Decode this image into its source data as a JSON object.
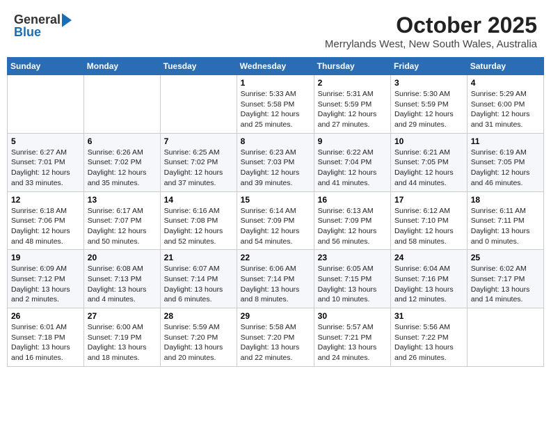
{
  "header": {
    "logo_line1": "General",
    "logo_line2": "Blue",
    "title": "October 2025",
    "subtitle": "Merrylands West, New South Wales, Australia"
  },
  "calendar": {
    "days_of_week": [
      "Sunday",
      "Monday",
      "Tuesday",
      "Wednesday",
      "Thursday",
      "Friday",
      "Saturday"
    ],
    "weeks": [
      [
        {
          "day": "",
          "info": ""
        },
        {
          "day": "",
          "info": ""
        },
        {
          "day": "",
          "info": ""
        },
        {
          "day": "1",
          "info": "Sunrise: 5:33 AM\nSunset: 5:58 PM\nDaylight: 12 hours and 25 minutes."
        },
        {
          "day": "2",
          "info": "Sunrise: 5:31 AM\nSunset: 5:59 PM\nDaylight: 12 hours and 27 minutes."
        },
        {
          "day": "3",
          "info": "Sunrise: 5:30 AM\nSunset: 5:59 PM\nDaylight: 12 hours and 29 minutes."
        },
        {
          "day": "4",
          "info": "Sunrise: 5:29 AM\nSunset: 6:00 PM\nDaylight: 12 hours and 31 minutes."
        }
      ],
      [
        {
          "day": "5",
          "info": "Sunrise: 6:27 AM\nSunset: 7:01 PM\nDaylight: 12 hours and 33 minutes."
        },
        {
          "day": "6",
          "info": "Sunrise: 6:26 AM\nSunset: 7:02 PM\nDaylight: 12 hours and 35 minutes."
        },
        {
          "day": "7",
          "info": "Sunrise: 6:25 AM\nSunset: 7:02 PM\nDaylight: 12 hours and 37 minutes."
        },
        {
          "day": "8",
          "info": "Sunrise: 6:23 AM\nSunset: 7:03 PM\nDaylight: 12 hours and 39 minutes."
        },
        {
          "day": "9",
          "info": "Sunrise: 6:22 AM\nSunset: 7:04 PM\nDaylight: 12 hours and 41 minutes."
        },
        {
          "day": "10",
          "info": "Sunrise: 6:21 AM\nSunset: 7:05 PM\nDaylight: 12 hours and 44 minutes."
        },
        {
          "day": "11",
          "info": "Sunrise: 6:19 AM\nSunset: 7:05 PM\nDaylight: 12 hours and 46 minutes."
        }
      ],
      [
        {
          "day": "12",
          "info": "Sunrise: 6:18 AM\nSunset: 7:06 PM\nDaylight: 12 hours and 48 minutes."
        },
        {
          "day": "13",
          "info": "Sunrise: 6:17 AM\nSunset: 7:07 PM\nDaylight: 12 hours and 50 minutes."
        },
        {
          "day": "14",
          "info": "Sunrise: 6:16 AM\nSunset: 7:08 PM\nDaylight: 12 hours and 52 minutes."
        },
        {
          "day": "15",
          "info": "Sunrise: 6:14 AM\nSunset: 7:09 PM\nDaylight: 12 hours and 54 minutes."
        },
        {
          "day": "16",
          "info": "Sunrise: 6:13 AM\nSunset: 7:09 PM\nDaylight: 12 hours and 56 minutes."
        },
        {
          "day": "17",
          "info": "Sunrise: 6:12 AM\nSunset: 7:10 PM\nDaylight: 12 hours and 58 minutes."
        },
        {
          "day": "18",
          "info": "Sunrise: 6:11 AM\nSunset: 7:11 PM\nDaylight: 13 hours and 0 minutes."
        }
      ],
      [
        {
          "day": "19",
          "info": "Sunrise: 6:09 AM\nSunset: 7:12 PM\nDaylight: 13 hours and 2 minutes."
        },
        {
          "day": "20",
          "info": "Sunrise: 6:08 AM\nSunset: 7:13 PM\nDaylight: 13 hours and 4 minutes."
        },
        {
          "day": "21",
          "info": "Sunrise: 6:07 AM\nSunset: 7:14 PM\nDaylight: 13 hours and 6 minutes."
        },
        {
          "day": "22",
          "info": "Sunrise: 6:06 AM\nSunset: 7:14 PM\nDaylight: 13 hours and 8 minutes."
        },
        {
          "day": "23",
          "info": "Sunrise: 6:05 AM\nSunset: 7:15 PM\nDaylight: 13 hours and 10 minutes."
        },
        {
          "day": "24",
          "info": "Sunrise: 6:04 AM\nSunset: 7:16 PM\nDaylight: 13 hours and 12 minutes."
        },
        {
          "day": "25",
          "info": "Sunrise: 6:02 AM\nSunset: 7:17 PM\nDaylight: 13 hours and 14 minutes."
        }
      ],
      [
        {
          "day": "26",
          "info": "Sunrise: 6:01 AM\nSunset: 7:18 PM\nDaylight: 13 hours and 16 minutes."
        },
        {
          "day": "27",
          "info": "Sunrise: 6:00 AM\nSunset: 7:19 PM\nDaylight: 13 hours and 18 minutes."
        },
        {
          "day": "28",
          "info": "Sunrise: 5:59 AM\nSunset: 7:20 PM\nDaylight: 13 hours and 20 minutes."
        },
        {
          "day": "29",
          "info": "Sunrise: 5:58 AM\nSunset: 7:20 PM\nDaylight: 13 hours and 22 minutes."
        },
        {
          "day": "30",
          "info": "Sunrise: 5:57 AM\nSunset: 7:21 PM\nDaylight: 13 hours and 24 minutes."
        },
        {
          "day": "31",
          "info": "Sunrise: 5:56 AM\nSunset: 7:22 PM\nDaylight: 13 hours and 26 minutes."
        },
        {
          "day": "",
          "info": ""
        }
      ]
    ]
  }
}
